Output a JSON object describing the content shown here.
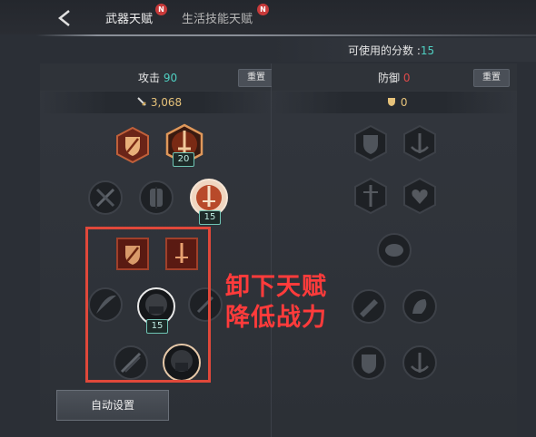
{
  "tabs": [
    {
      "label": "武器天赋",
      "badge": "N"
    },
    {
      "label": "生活技能天赋",
      "badge": "N"
    }
  ],
  "points": {
    "label": "可使用的分数 :",
    "value": "15"
  },
  "attack": {
    "title": "攻击",
    "value": "90",
    "reset_label": "重置",
    "stat_value": "3,068"
  },
  "defense": {
    "title": "防御",
    "value": "0",
    "reset_label": "重置",
    "stat_value": "0"
  },
  "levels": {
    "crest_sword": "20",
    "sword_wing": "15",
    "round_helmet": "15"
  },
  "annotation": {
    "line1": "卸下天赋",
    "line2": "降低战力"
  },
  "auto_button": "自动设置",
  "colors": {
    "accent_teal": "#4fd0c2",
    "warning_red": "#e0483a",
    "gold": "#e6c27a"
  },
  "icons": [
    "back-arrow-icon",
    "sword-stat-icon",
    "shield-stat-icon"
  ]
}
